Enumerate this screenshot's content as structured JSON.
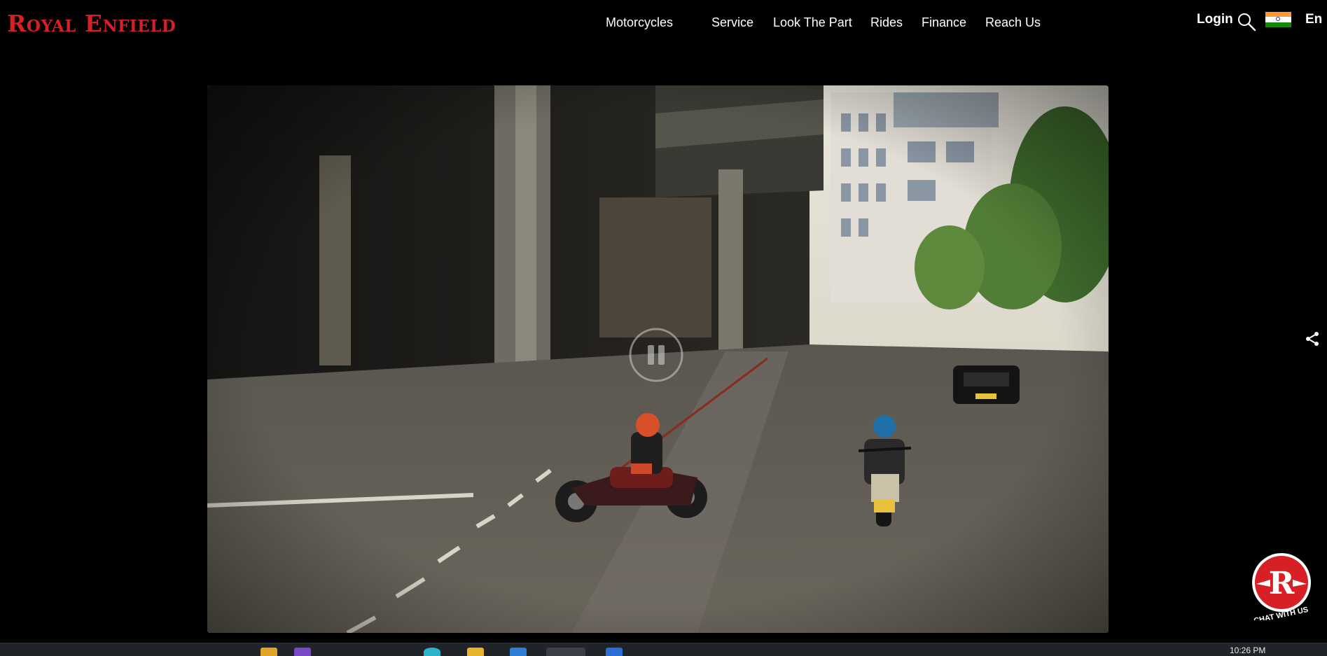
{
  "header": {
    "logo_text": "Royal Enfield",
    "nav_items": [
      "Motorcycles",
      "Service",
      "Look The Part",
      "Rides",
      "Finance",
      "Reach Us"
    ],
    "login_label": "Login",
    "language_label": "En",
    "search_icon": "search-icon",
    "flag_icon": "india-flag-icon"
  },
  "video": {
    "state": "playing",
    "control_icon": "pause-icon"
  },
  "share_icon": "share-icon",
  "chat": {
    "label": "CHAT WITH US",
    "logo_letter": "R"
  },
  "taskbar": {
    "clock": "10:26 PM"
  },
  "colors": {
    "brand_red": "#d71f26",
    "background": "#000000"
  }
}
